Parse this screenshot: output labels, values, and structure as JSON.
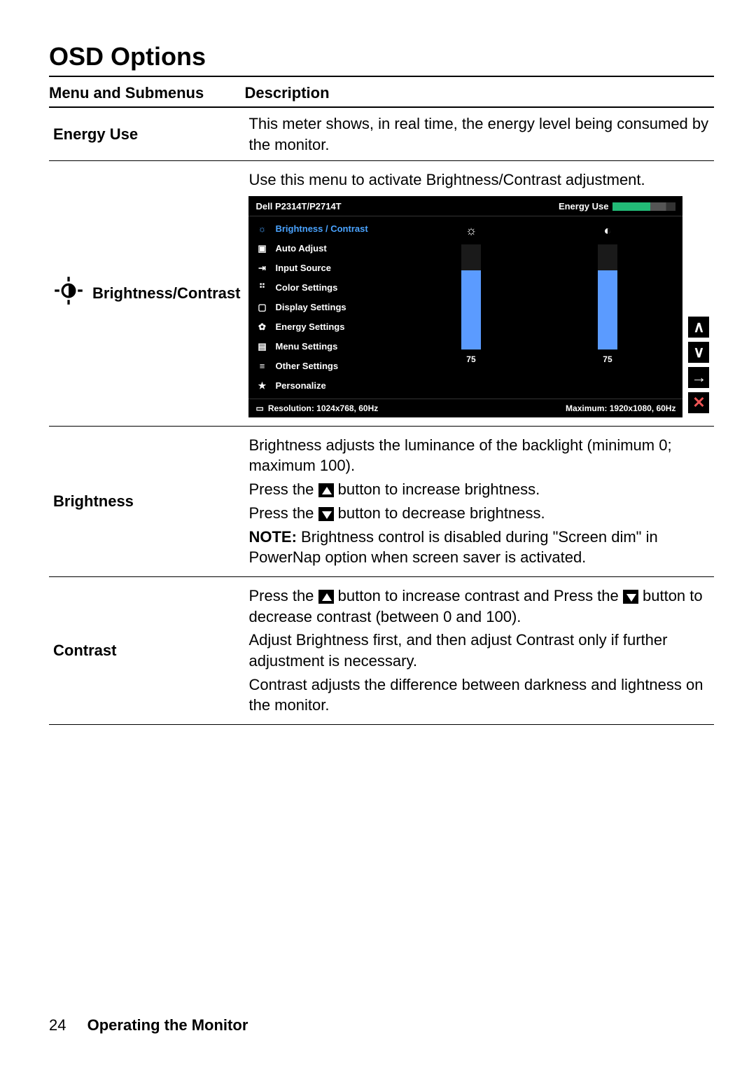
{
  "page_title": "OSD Options",
  "columns": {
    "menu": "Menu and Submenus",
    "desc": "Description"
  },
  "rows": {
    "energy": {
      "label": "Energy Use",
      "desc": "This meter shows, in real time, the energy level being consumed by the monitor."
    },
    "bc": {
      "label": "Brightness/Contrast",
      "intro": "Use this menu to activate Brightness/Contrast adjustment."
    },
    "brightness": {
      "label": "Brightness",
      "p1": "Brightness adjusts the luminance of the backlight (minimum 0; maximum 100).",
      "p2a": "Press the ",
      "p2b": " button to increase brightness.",
      "p3a": "Press the ",
      "p3b": " button to decrease brightness.",
      "note_label": "NOTE:",
      "note_body": " Brightness control is disabled during \"Screen dim\" in PowerNap option when screen saver is activated."
    },
    "contrast": {
      "label": "Contrast",
      "p1a": "Press the ",
      "p1b": " button to increase contrast and Press the ",
      "p1c": " button to decrease contrast (between 0 and 100).",
      "p2": "Adjust Brightness first, and then adjust Contrast only if further adjustment is necessary.",
      "p3": "Contrast adjusts the difference between darkness and lightness on the monitor."
    }
  },
  "osd_preview": {
    "model": "Dell P2314T/P2714T",
    "energy_label": "Energy Use",
    "menu": [
      "Brightness / Contrast",
      "Auto Adjust",
      "Input Source",
      "Color Settings",
      "Display Settings",
      "Energy Settings",
      "Menu Settings",
      "Other Settings",
      "Personalize"
    ],
    "brightness_value": "75",
    "contrast_value": "75",
    "resolution_label": "Resolution: 1024x768, 60Hz",
    "maximum_label": "Maximum: 1920x1080, 60Hz",
    "nav": {
      "up": "∧",
      "down": "∨",
      "enter": "→",
      "close": "✕"
    }
  },
  "footer": {
    "page_number": "24",
    "section": "Operating the Monitor"
  }
}
